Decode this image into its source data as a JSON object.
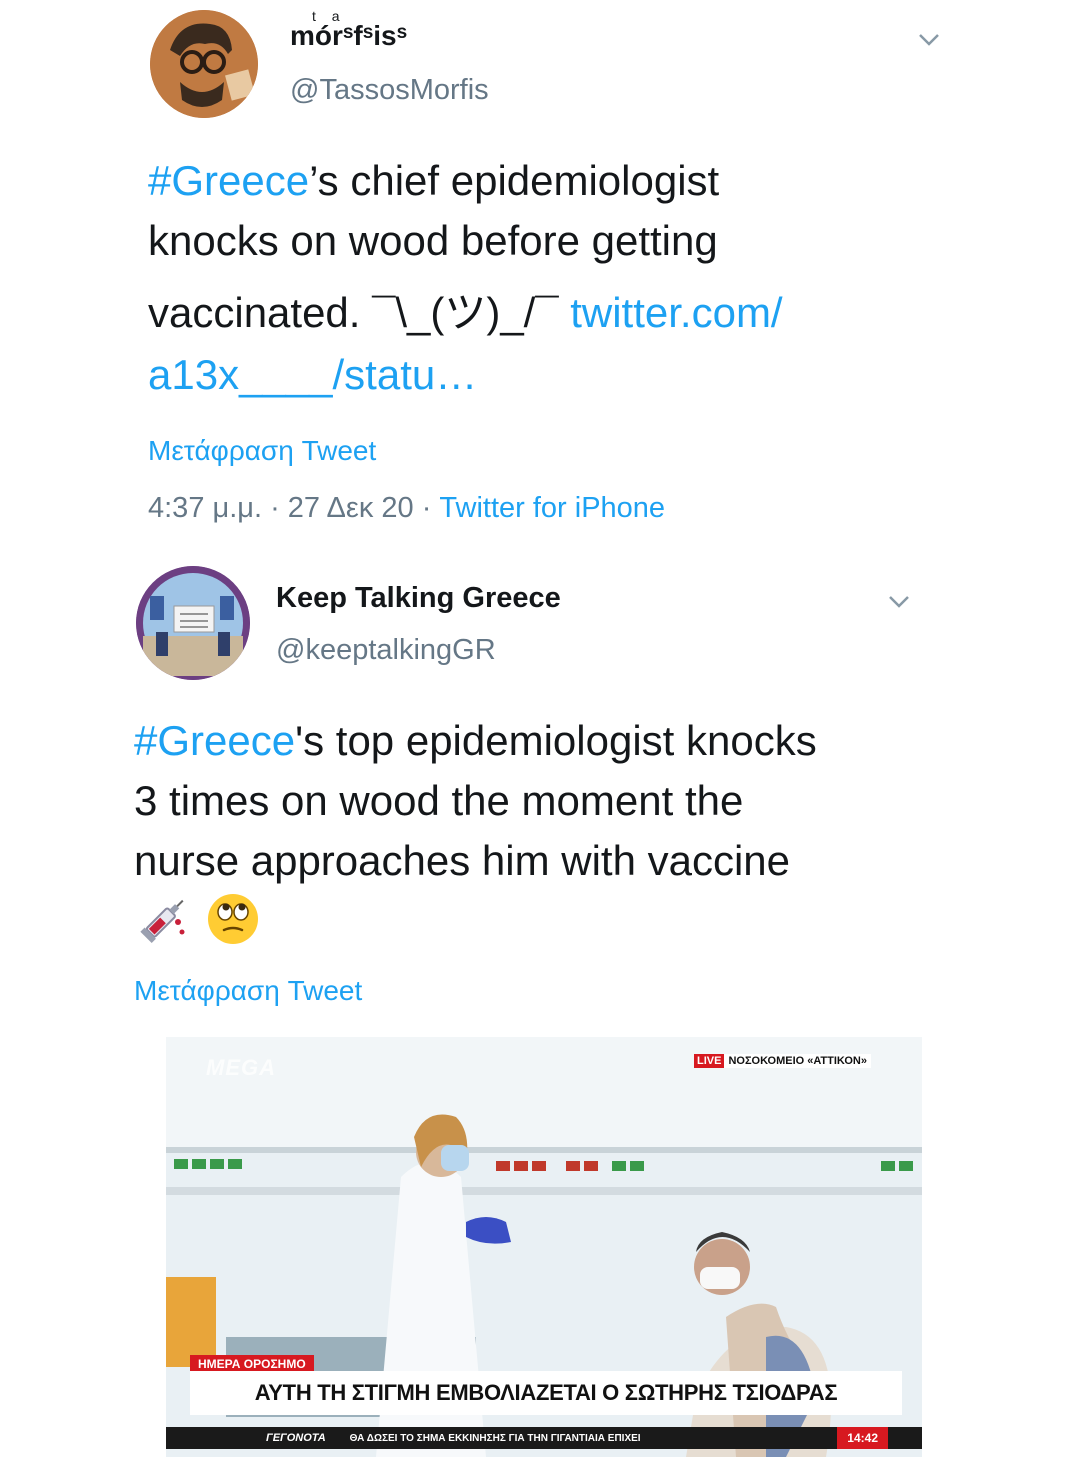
{
  "tweet1": {
    "display_name": "mórˢfˢisˢ",
    "name_accent": "t a",
    "handle": "@TassosMorfis",
    "text_hashtag": "#Greece",
    "text_line1_rest": "’s chief epidemiologist",
    "text_line2": "knocks on wood before getting",
    "text_line3": "vaccinated. ¯\\_(ツ)_/¯",
    "text_link_part1": "twitter.com/",
    "text_link_part2": "a13x____/statu…",
    "translate": "Μετάφραση Tweet",
    "time_date": "4:37 μ.μ. · 27 Δεκ 20 · ",
    "source": "Twitter for iPhone"
  },
  "tweet2": {
    "display_name": "Keep Talking Greece",
    "handle": "@keeptalkingGR",
    "text_hashtag": "#Greece",
    "text_line1_rest": "'s top epidemiologist knocks",
    "text_line2": "3 times on wood the moment the",
    "text_line3": "nurse approaches him with vaccine",
    "emoji": [
      "syringe",
      "face-with-rolling-eyes"
    ],
    "translate": "Μετάφραση Tweet"
  },
  "video": {
    "channel_logo": "MEGA",
    "live_badge": "LIVE",
    "location": "ΝΟΣΟΚΟΜΕΙΟ «ΑΤΤΙΚΟΝ»",
    "tag": "ΗΜΕΡΑ ΟΡΟΣΗΜΟ",
    "headline": "ΑΥΤΗ ΤΗ ΣΤΙΓΜΗ ΕΜΒΟΛΙΑΖΕΤΑΙ Ο ΣΩΤΗΡΗΣ ΤΣΙΟΔΡΑΣ",
    "ticker_brand": "ΓΕΓΟΝΟΤΑ",
    "ticker_text": "ΘΑ ΔΩΣΕΙ ΤΟ ΣΗΜΑ ΕΚΚΙΝΗΣΗΣ ΓΙΑ ΤΗΝ ΓΙΓΑΝΤΙΑΙΑ ΕΠΙΧΕΙ",
    "clock": "14:42"
  },
  "colors": {
    "link": "#1da1f2",
    "muted": "#657786",
    "live_red": "#d71920"
  }
}
